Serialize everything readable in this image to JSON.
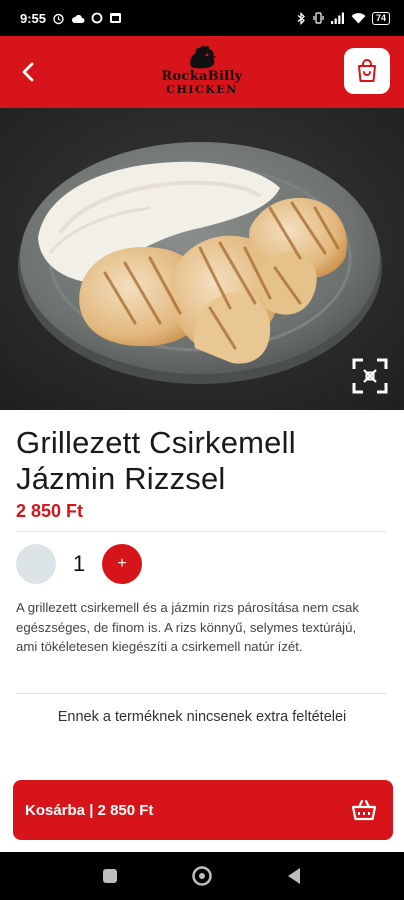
{
  "status_bar": {
    "time": "9:55",
    "battery": "74",
    "icons": [
      "alarm-icon",
      "cloud-icon",
      "circle-icon",
      "cast-icon",
      "bluetooth-icon",
      "vibrate-icon",
      "signal-icon",
      "wifi-icon",
      "battery-icon"
    ]
  },
  "header": {
    "back_icon": "chevron-left-icon",
    "logo_line1": "RockaBilly",
    "logo_line2": "CHICKEN",
    "cart_icon": "shopping-bag-icon"
  },
  "hero": {
    "image_icon": "grilled-chicken-rice-photo",
    "expand_icon": "fullscreen-icon"
  },
  "product": {
    "title": "Grillezett Csirkemell Jázmin Rizzsel",
    "price": "2 850 Ft",
    "quantity": "1",
    "plus_label": "+",
    "description": "A grillezett csirkemell és a jázmin rizs párosítása nem csak egészséges, de finom is. A rizs könnyű, selymes textúrájú, ami tökéletesen kiegészíti a csirkemell natúr ízét.",
    "no_extras": "Ennek a terméknek nincsenek extra feltételei"
  },
  "cart_button": {
    "label": "Kosárba | 2 850 Ft",
    "icon": "basket-icon"
  },
  "colors": {
    "brand_red": "#d7141a",
    "minus_button": "#dde4e7",
    "status_bar": "#000000"
  }
}
